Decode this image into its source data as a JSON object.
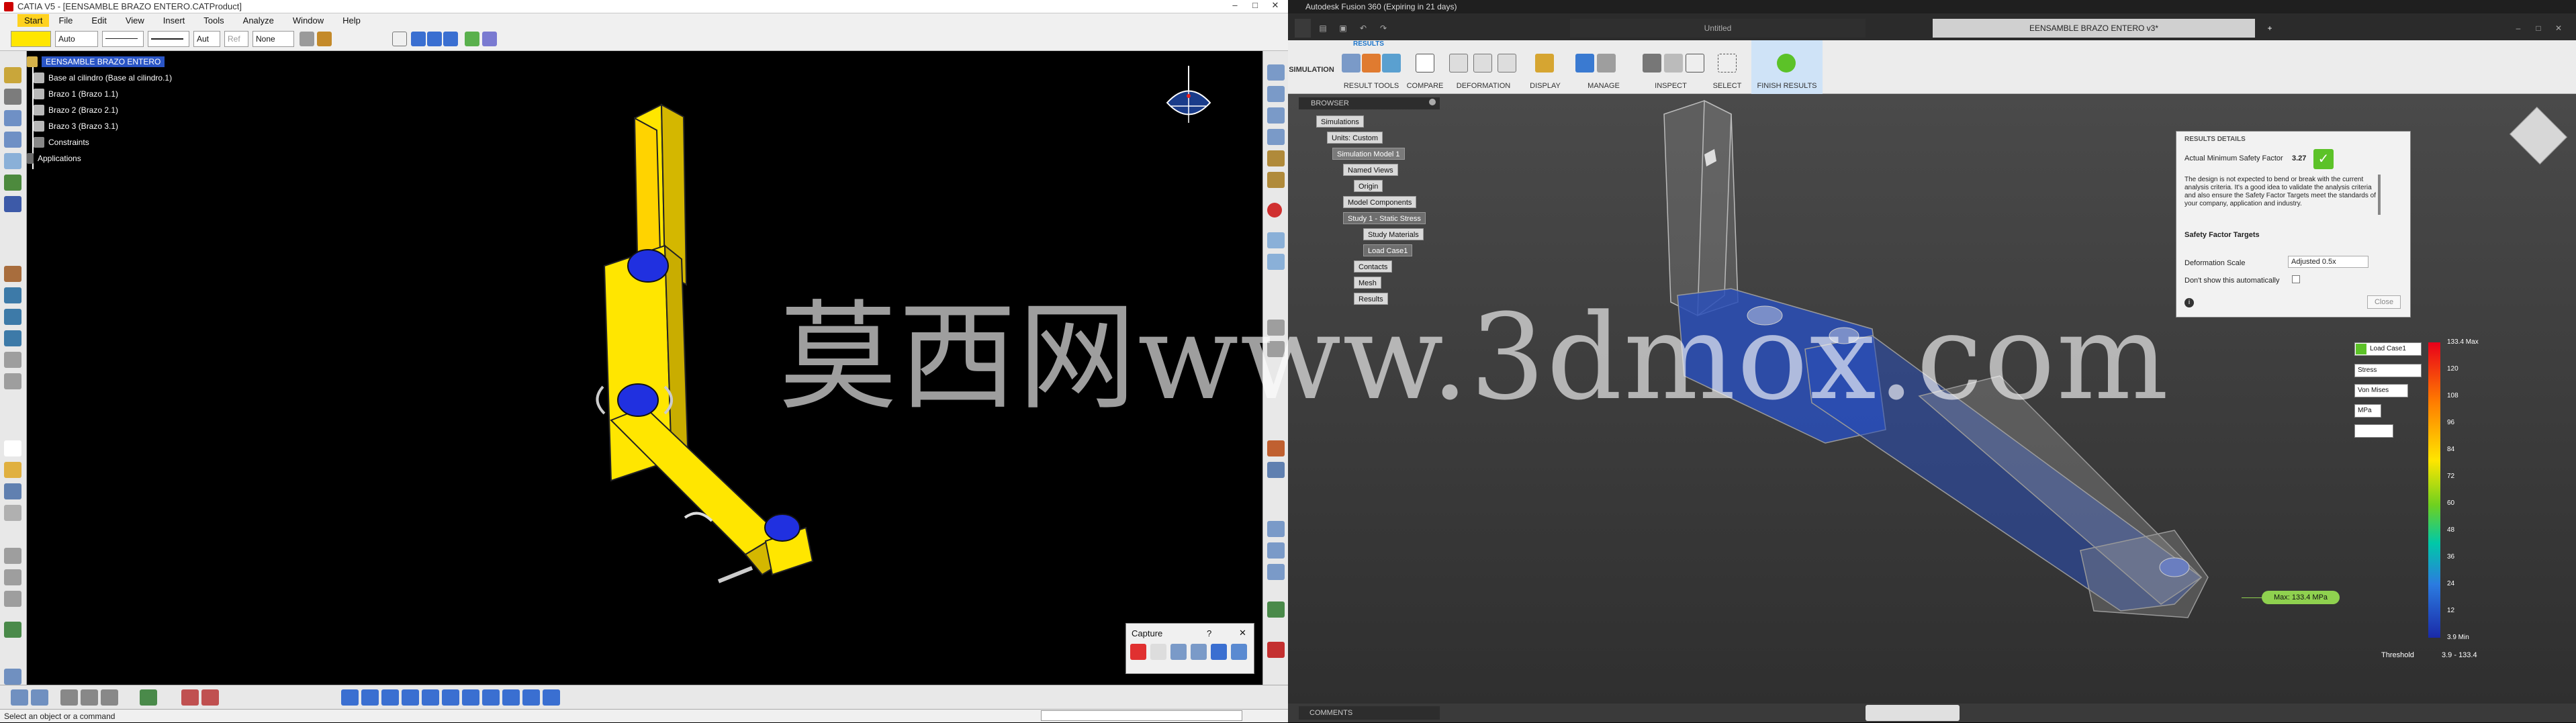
{
  "catia": {
    "window_title": "CATIA V5 - [EENSAMBLE BRAZO ENTERO.CATProduct]",
    "menu": [
      "Start",
      "File",
      "Edit",
      "View",
      "Insert",
      "Tools",
      "Analyze",
      "Window",
      "Help"
    ],
    "props": {
      "color": "",
      "transparency": "Auto",
      "linetype": "",
      "thickness": "",
      "layer": "Aut",
      "ref": "Ref",
      "style": "None"
    },
    "tree": {
      "root": "EENSAMBLE BRAZO ENTERO",
      "items": [
        "Base al cilindro (Base al cilindro.1)",
        "Brazo 1 (Brazo 1.1)",
        "Brazo 2 (Brazo 2.1)",
        "Brazo 3 (Brazo 3.1)",
        "Constraints",
        "Applications"
      ]
    },
    "capture": {
      "title": "Capture",
      "help": "?",
      "close": "✕"
    },
    "status": "Select an object or a command"
  },
  "fusion": {
    "window_title": "Autodesk Fusion 360 (Expiring in 21 days)",
    "tab_untitled": "Untitled",
    "tab_active": "EENSAMBLE BRAZO ENTERO v3*",
    "ribbon_mode": "SIMULATION",
    "ribbon_tab": "RESULTS",
    "groups": [
      "RESULT TOOLS",
      "COMPARE",
      "DEFORMATION",
      "DISPLAY",
      "MANAGE",
      "INSPECT",
      "SELECT",
      "FINISH RESULTS"
    ],
    "browser_title": "BROWSER",
    "browser": {
      "simulations": "Simulations",
      "units": "Units: Custom",
      "model": "Simulation Model 1",
      "named_views": "Named Views",
      "origin": "Origin",
      "model_components": "Model Components",
      "study": "Study 1 - Static Stress",
      "study_materials": "Study Materials",
      "load_case": "Load Case1",
      "contacts": "Contacts",
      "mesh": "Mesh",
      "results": "Results"
    },
    "results_details": {
      "title": "RESULTS DETAILS",
      "sf_label": "Actual Minimum Safety Factor",
      "sf_value": "3.27",
      "message": "The design is not expected to bend or break with the current analysis criteria. It's a good idea to validate the analysis criteria and also ensure the Safety Factor Targets meet the standards of your company, application and industry.",
      "targets": "Safety Factor Targets",
      "deform_label": "Deformation Scale",
      "deform_value": "Adjusted 0.5x",
      "dont_show": "Don't show this automatically",
      "close": "Close"
    },
    "legend": {
      "load_case": "Load Case1",
      "result": "Stress",
      "component": "Von Mises",
      "units": "MPa",
      "ticks": [
        "133.4 Max",
        "120",
        "108",
        "96",
        "84",
        "72",
        "60",
        "48",
        "36",
        "24",
        "12",
        "3.9 Min"
      ],
      "threshold_label": "Threshold",
      "threshold_value": "3.9 - 133.4"
    },
    "max_tag": "Max: 133.4 MPa",
    "comments": "COMMENTS"
  },
  "watermark": "莫西网www.3dmox.com",
  "colors": {
    "catia_yellow": "#ffe600",
    "catia_blue": "#2030e0",
    "fusion_blue": "#2a4fb8",
    "highlight": "#2a55c6",
    "accept_green": "#5cc228"
  }
}
